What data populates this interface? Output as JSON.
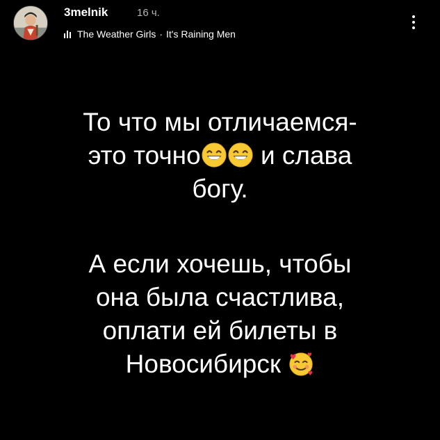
{
  "header": {
    "username": "3melnik",
    "timestamp": "16 ч.",
    "music": {
      "icon": "music-bars-icon",
      "artist": "The Weather Girls",
      "separator": "·",
      "title": "It's Raining Men"
    },
    "more_icon": "more-vertical-icon"
  },
  "story": {
    "paragraphs": [
      {
        "lines": [
          "То что мы отличаемся-",
          "это точно",
          "и слава",
          "богу."
        ]
      },
      {
        "lines": [
          "А если хочешь, чтобы",
          "она была счастлива,",
          "оплати ей билеты в",
          "Новосибирск"
        ]
      }
    ],
    "emojis": {
      "grinning": "grinning-face-emoji",
      "smiling_hearts": "smiling-face-with-hearts-emoji"
    }
  },
  "colors": {
    "background": "#000000",
    "text": "#ffffff",
    "timestamp": "#b5b5b5"
  }
}
